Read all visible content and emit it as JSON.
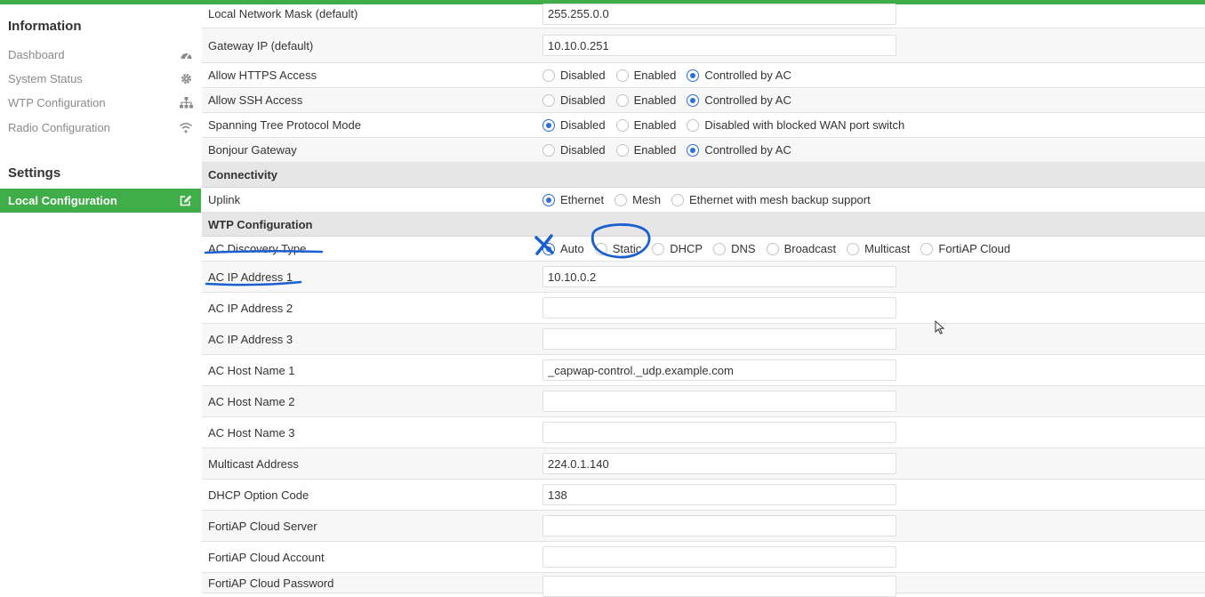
{
  "sidebar": {
    "info_heading": "Information",
    "info_items": [
      {
        "label": "Dashboard",
        "icon": "dashboard-icon"
      },
      {
        "label": "System Status",
        "icon": "gear-icon"
      },
      {
        "label": "WTP Configuration",
        "icon": "network-tree-icon"
      },
      {
        "label": "Radio Configuration",
        "icon": "wifi-icon"
      }
    ],
    "settings_heading": "Settings",
    "settings_items": [
      {
        "label": "Local Configuration",
        "icon": "edit-icon",
        "active": true
      }
    ]
  },
  "form": {
    "local_network_mask": {
      "label": "Local Network Mask (default)",
      "value": "255.255.0.0"
    },
    "gateway_ip": {
      "label": "Gateway IP (default)",
      "value": "10.10.0.251"
    },
    "allow_https": {
      "label": "Allow HTTPS Access",
      "options": [
        "Disabled",
        "Enabled",
        "Controlled by AC"
      ],
      "selected": "Controlled by AC"
    },
    "allow_ssh": {
      "label": "Allow SSH Access",
      "options": [
        "Disabled",
        "Enabled",
        "Controlled by AC"
      ],
      "selected": "Controlled by AC"
    },
    "stp_mode": {
      "label": "Spanning Tree Protocol Mode",
      "options": [
        "Disabled",
        "Enabled",
        "Disabled with blocked WAN port switch"
      ],
      "selected": "Disabled"
    },
    "bonjour": {
      "label": "Bonjour Gateway",
      "options": [
        "Disabled",
        "Enabled",
        "Controlled by AC"
      ],
      "selected": "Controlled by AC"
    },
    "connectivity_heading": "Connectivity",
    "uplink": {
      "label": "Uplink",
      "options": [
        "Ethernet",
        "Mesh",
        "Ethernet with mesh backup support"
      ],
      "selected": "Ethernet"
    },
    "wtp_heading": "WTP Configuration",
    "ac_discovery": {
      "label": "AC Discovery Type",
      "options": [
        "Auto",
        "Static",
        "DHCP",
        "DNS",
        "Broadcast",
        "Multicast",
        "FortiAP Cloud"
      ],
      "selected": "Auto"
    },
    "ac_ip_1": {
      "label": "AC IP Address 1",
      "value": "10.10.0.2"
    },
    "ac_ip_2": {
      "label": "AC IP Address 2",
      "value": ""
    },
    "ac_ip_3": {
      "label": "AC IP Address 3",
      "value": ""
    },
    "ac_host_1": {
      "label": "AC Host Name 1",
      "value": "_capwap-control._udp.example.com"
    },
    "ac_host_2": {
      "label": "AC Host Name 2",
      "value": ""
    },
    "ac_host_3": {
      "label": "AC Host Name 3",
      "value": ""
    },
    "multicast_address": {
      "label": "Multicast Address",
      "value": "224.0.1.140"
    },
    "dhcp_option_code": {
      "label": "DHCP Option Code",
      "value": "138"
    },
    "fortiap_cloud_server": {
      "label": "FortiAP Cloud Server",
      "value": ""
    },
    "fortiap_cloud_account": {
      "label": "FortiAP Cloud Account",
      "value": ""
    },
    "fortiap_cloud_password": {
      "label": "FortiAP Cloud Password",
      "value": ""
    }
  },
  "colors": {
    "accent": "#3fae49",
    "radio": "#2d6fd4",
    "annotation": "#1a5fd0"
  }
}
